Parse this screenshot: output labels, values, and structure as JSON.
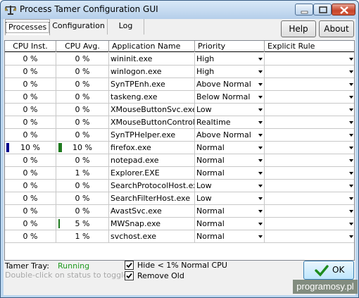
{
  "window": {
    "title": "Process Tamer Configuration GUI",
    "controls": [
      "minimize-icon",
      "maximize-icon",
      "close-icon"
    ]
  },
  "tabs": [
    {
      "label": "Processes",
      "active": true
    },
    {
      "label": "Configuration",
      "active": false
    },
    {
      "label": "Log",
      "active": false
    }
  ],
  "buttons": {
    "help": "Help",
    "about": "About",
    "ok": "OK"
  },
  "columns": [
    "CPU Inst.",
    "CPU Avg.",
    "Application Name",
    "Priority",
    "Explicit Rule"
  ],
  "rows": [
    {
      "cpu_inst": "0 %",
      "cpu_avg": "0 %",
      "name": "wininit.exe",
      "priority": "High",
      "rule": ""
    },
    {
      "cpu_inst": "0 %",
      "cpu_avg": "0 %",
      "name": "winlogon.exe",
      "priority": "High",
      "rule": ""
    },
    {
      "cpu_inst": "0 %",
      "cpu_avg": "0 %",
      "name": "SynTPEnh.exe",
      "priority": "Above Normal",
      "rule": ""
    },
    {
      "cpu_inst": "0 %",
      "cpu_avg": "0 %",
      "name": "taskeng.exe",
      "priority": "Below Normal",
      "rule": ""
    },
    {
      "cpu_inst": "0 %",
      "cpu_avg": "0 %",
      "name": "XMouseButtonSvc.exe",
      "priority": "Low",
      "rule": ""
    },
    {
      "cpu_inst": "0 %",
      "cpu_avg": "0 %",
      "name": "XMouseButtonControl.exe",
      "priority": "Realtime",
      "rule": ""
    },
    {
      "cpu_inst": "0 %",
      "cpu_avg": "0 %",
      "name": "SynTPHelper.exe",
      "priority": "Above Normal",
      "rule": ""
    },
    {
      "cpu_inst": "10 %",
      "cpu_avg": "10 %",
      "name": "firefox.exe",
      "priority": "Normal",
      "rule": "",
      "inst_bar_color": "#00008b",
      "avg_bar_color": "#1e7a1e"
    },
    {
      "cpu_inst": "0 %",
      "cpu_avg": "0 %",
      "name": "notepad.exe",
      "priority": "Normal",
      "rule": ""
    },
    {
      "cpu_inst": "0 %",
      "cpu_avg": "1 %",
      "name": "Explorer.EXE",
      "priority": "Normal",
      "rule": ""
    },
    {
      "cpu_inst": "0 %",
      "cpu_avg": "0 %",
      "name": "SearchProtocolHost.exe",
      "priority": "Low",
      "rule": ""
    },
    {
      "cpu_inst": "0 %",
      "cpu_avg": "0 %",
      "name": "SearchFilterHost.exe",
      "priority": "Low",
      "rule": ""
    },
    {
      "cpu_inst": "0 %",
      "cpu_avg": "0 %",
      "name": "AvastSvc.exe",
      "priority": "Normal",
      "rule": ""
    },
    {
      "cpu_inst": "0 %",
      "cpu_avg": "5 %",
      "name": "MWSnap.exe",
      "priority": "Normal",
      "rule": "",
      "avg_bar_color": "#1e7a1e"
    },
    {
      "cpu_inst": "0 %",
      "cpu_avg": "1 %",
      "name": "svchost.exe",
      "priority": "Normal",
      "rule": ""
    }
  ],
  "footer": {
    "tray_label": "Tamer Tray:",
    "tray_status": "Running",
    "tray_status_color": "#1f9a1f",
    "hint": "Double-click on status to toggle.",
    "hide_label": "Hide < 1% Normal CPU",
    "hide_checked": true,
    "remove_label": "Remove Old",
    "remove_checked": true
  },
  "watermark": "programosy.pl"
}
